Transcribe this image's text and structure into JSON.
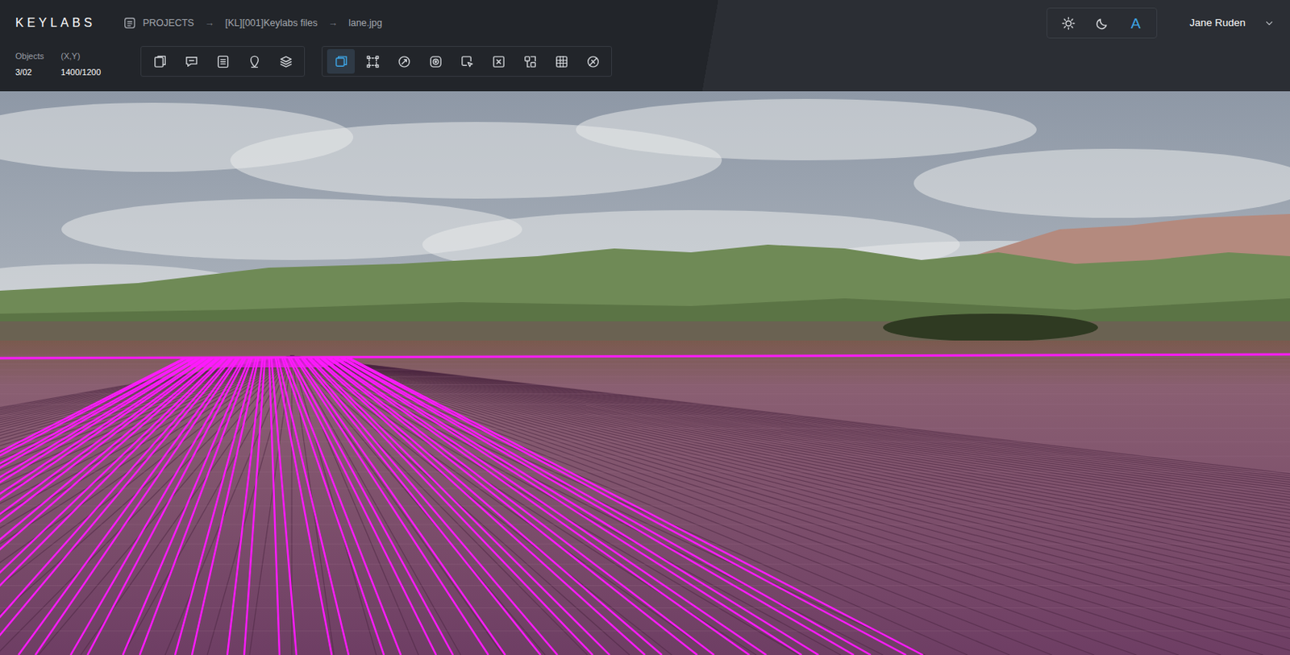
{
  "app": {
    "logo": "KEYLABS"
  },
  "breadcrumb": {
    "separator": "→",
    "items": [
      {
        "label": "PROJECTS"
      },
      {
        "label": "[KL][001]Keylabs files"
      },
      {
        "label": "lane.jpg"
      }
    ]
  },
  "stats": [
    {
      "label": "Objects",
      "value": "3/02"
    },
    {
      "label": "(X,Y)",
      "value": "1400/1200"
    }
  ],
  "tools": {
    "primary": [
      {
        "kind": "page",
        "selected": false
      },
      {
        "kind": "comment",
        "selected": false
      },
      {
        "kind": "list",
        "selected": false
      },
      {
        "kind": "tag",
        "selected": false
      },
      {
        "kind": "layers",
        "selected": false
      }
    ],
    "drawing": [
      {
        "kind": "box",
        "selected": true
      },
      {
        "kind": "points",
        "selected": false
      },
      {
        "kind": "polygon",
        "selected": false
      },
      {
        "kind": "target",
        "selected": false
      },
      {
        "kind": "cursor",
        "selected": false
      },
      {
        "kind": "cross",
        "selected": false
      },
      {
        "kind": "split",
        "selected": false
      },
      {
        "kind": "grid",
        "selected": false
      },
      {
        "kind": "erase",
        "selected": false
      }
    ]
  },
  "theme": [
    {
      "kind": "sun",
      "selected": false
    },
    {
      "kind": "moon",
      "selected": false
    },
    {
      "kind": "text",
      "label": "A",
      "selected": true
    }
  ],
  "user": {
    "name": "Jane Ruden"
  }
}
